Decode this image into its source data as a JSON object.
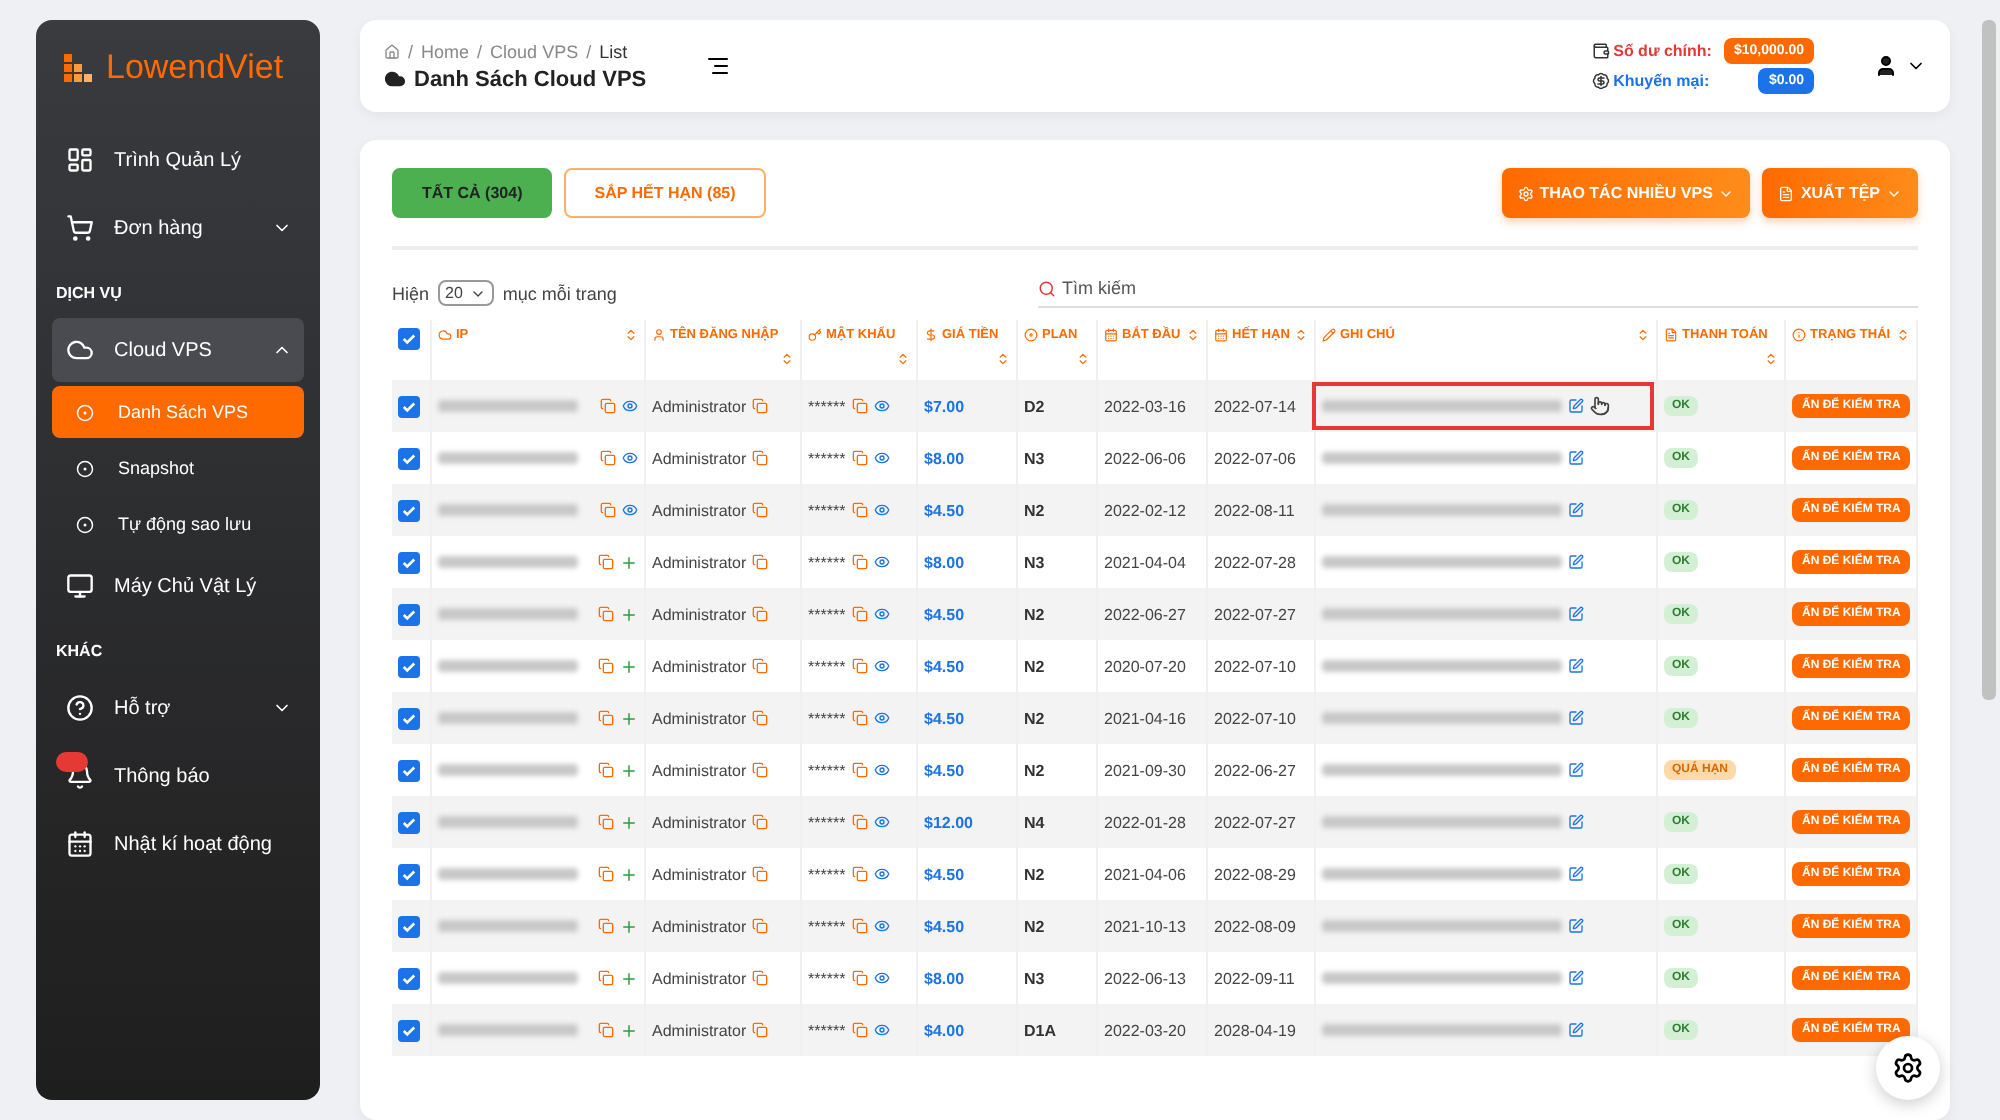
{
  "sidebar": {
    "logo": "LowendViet",
    "items": [
      {
        "kind": "item",
        "label": "Trình Quản Lý",
        "expandable": false,
        "expanded": false,
        "selected": false
      },
      {
        "kind": "item",
        "label": "Đơn hàng",
        "expandable": true,
        "expanded": false,
        "selected": false
      },
      {
        "kind": "section",
        "label": "DỊCH VỤ"
      },
      {
        "kind": "item",
        "label": "Cloud VPS",
        "expandable": true,
        "expanded": true,
        "selected": false
      },
      {
        "kind": "subitem",
        "label": "Danh Sách VPS",
        "selected": true
      },
      {
        "kind": "subitem",
        "label": "Snapshot",
        "selected": false
      },
      {
        "kind": "subitem",
        "label": "Tự động sao lưu",
        "selected": false
      },
      {
        "kind": "item",
        "label": "Máy Chủ Vật Lý",
        "expandable": false,
        "expanded": false,
        "selected": false
      },
      {
        "kind": "section",
        "label": "KHÁC"
      },
      {
        "kind": "item",
        "label": "Hỗ trợ",
        "expandable": true,
        "expanded": false,
        "selected": false
      },
      {
        "kind": "item",
        "label": "Thông báo",
        "expandable": false,
        "expanded": false,
        "selected": false,
        "badge": true
      },
      {
        "kind": "item",
        "label": "Nhật kí hoạt động",
        "expandable": false,
        "expanded": false,
        "selected": false
      }
    ]
  },
  "header": {
    "breadcrumb": [
      "Home",
      "Cloud VPS",
      "List"
    ],
    "separator": "/",
    "title": "Danh Sách Cloud VPS",
    "balance_label": "Số dư chính:",
    "balance": "$10,000.00",
    "promo_label": "Khuyến mại:",
    "promo": "$0.00"
  },
  "tabs": [
    {
      "label": "TẤT CẢ (304)",
      "selected": true
    },
    {
      "label": "SẮP HẾT HẠN (85)",
      "selected": false
    }
  ],
  "actions": [
    "THAO TÁC NHIỀU VPS",
    "XUẤT TỆP"
  ],
  "page_size": {
    "prefix": "Hiện",
    "value": "20",
    "suffix": "mục mỗi trang"
  },
  "search": {
    "placeholder": "Tìm kiếm"
  },
  "table": {
    "all_checked": true,
    "columns": [
      {
        "label": "IP"
      },
      {
        "label": "TÊN ĐĂNG NHẬP"
      },
      {
        "label": "MẬT KHẨU"
      },
      {
        "label": "GIÁ TIỀN"
      },
      {
        "label": "PLAN"
      },
      {
        "label": "BẮT ĐẦU"
      },
      {
        "label": "HẾT HẠN"
      },
      {
        "label": "GHI CHÚ"
      },
      {
        "label": "THANH TOÁN"
      },
      {
        "label": "TRẠNG THÁI"
      }
    ],
    "rows": [
      {
        "checked": true,
        "kind": "view",
        "user": "Administrator",
        "password": "******",
        "price": "$7.00",
        "plan": "D2",
        "start": "2022-03-16",
        "end": "2022-07-14",
        "note_highlighted": true,
        "payment": {
          "kind": "paid",
          "label": "OK"
        },
        "status": "ẤN ĐỂ KIỂM TRA"
      },
      {
        "checked": true,
        "kind": "view",
        "user": "Administrator",
        "password": "******",
        "price": "$8.00",
        "plan": "N3",
        "start": "2022-06-06",
        "end": "2022-07-06",
        "note_highlighted": false,
        "payment": {
          "kind": "paid",
          "label": "OK"
        },
        "status": "ẤN ĐỂ KIỂM TRA"
      },
      {
        "checked": true,
        "kind": "view",
        "user": "Administrator",
        "password": "******",
        "price": "$4.50",
        "plan": "N2",
        "start": "2022-02-12",
        "end": "2022-08-11",
        "note_highlighted": false,
        "payment": {
          "kind": "paid",
          "label": "OK"
        },
        "status": "ẤN ĐỂ KIỂM TRA"
      },
      {
        "checked": true,
        "kind": "add",
        "user": "Administrator",
        "password": "******",
        "price": "$8.00",
        "plan": "N3",
        "start": "2021-04-04",
        "end": "2022-07-28",
        "note_highlighted": false,
        "payment": {
          "kind": "paid",
          "label": "OK"
        },
        "status": "ẤN ĐỂ KIỂM TRA"
      },
      {
        "checked": true,
        "kind": "add",
        "user": "Administrator",
        "password": "******",
        "price": "$4.50",
        "plan": "N2",
        "start": "2022-06-27",
        "end": "2022-07-27",
        "note_highlighted": false,
        "payment": {
          "kind": "paid",
          "label": "OK"
        },
        "status": "ẤN ĐỂ KIỂM TRA"
      },
      {
        "checked": true,
        "kind": "add",
        "user": "Administrator",
        "password": "******",
        "price": "$4.50",
        "plan": "N2",
        "start": "2020-07-20",
        "end": "2022-07-10",
        "note_highlighted": false,
        "payment": {
          "kind": "paid",
          "label": "OK"
        },
        "status": "ẤN ĐỂ KIỂM TRA"
      },
      {
        "checked": true,
        "kind": "add",
        "user": "Administrator",
        "password": "******",
        "price": "$4.50",
        "plan": "N2",
        "start": "2021-04-16",
        "end": "2022-07-10",
        "note_highlighted": false,
        "payment": {
          "kind": "paid",
          "label": "OK"
        },
        "status": "ẤN ĐỂ KIỂM TRA"
      },
      {
        "checked": true,
        "kind": "add",
        "user": "Administrator",
        "password": "******",
        "price": "$4.50",
        "plan": "N2",
        "start": "2021-09-30",
        "end": "2022-06-27",
        "note_highlighted": false,
        "payment": {
          "kind": "overdue",
          "label": "QUÁ HẠN"
        },
        "status": "ẤN ĐỂ KIỂM TRA"
      },
      {
        "checked": true,
        "kind": "add",
        "user": "Administrator",
        "password": "******",
        "price": "$12.00",
        "plan": "N4",
        "start": "2022-01-28",
        "end": "2022-07-27",
        "note_highlighted": false,
        "payment": {
          "kind": "paid",
          "label": "OK"
        },
        "status": "ẤN ĐỂ KIỂM TRA"
      },
      {
        "checked": true,
        "kind": "add",
        "user": "Administrator",
        "password": "******",
        "price": "$4.50",
        "plan": "N2",
        "start": "2021-04-06",
        "end": "2022-08-29",
        "note_highlighted": false,
        "payment": {
          "kind": "paid",
          "label": "OK"
        },
        "status": "ẤN ĐỂ KIỂM TRA"
      },
      {
        "checked": true,
        "kind": "add",
        "user": "Administrator",
        "password": "******",
        "price": "$4.50",
        "plan": "N2",
        "start": "2021-10-13",
        "end": "2022-08-09",
        "note_highlighted": false,
        "payment": {
          "kind": "paid",
          "label": "OK"
        },
        "status": "ẤN ĐỂ KIỂM TRA"
      },
      {
        "checked": true,
        "kind": "add",
        "user": "Administrator",
        "password": "******",
        "price": "$8.00",
        "plan": "N3",
        "start": "2022-06-13",
        "end": "2022-09-11",
        "note_highlighted": false,
        "payment": {
          "kind": "paid",
          "label": "OK"
        },
        "status": "ẤN ĐỂ KIỂM TRA"
      },
      {
        "checked": true,
        "kind": "add",
        "user": "Administrator",
        "password": "******",
        "price": "$4.00",
        "plan": "D1A",
        "start": "2022-03-20",
        "end": "2028-04-19",
        "note_highlighted": false,
        "payment": {
          "kind": "paid",
          "label": "OK"
        },
        "status": "ẤN ĐỂ KIỂM TRA"
      }
    ]
  }
}
